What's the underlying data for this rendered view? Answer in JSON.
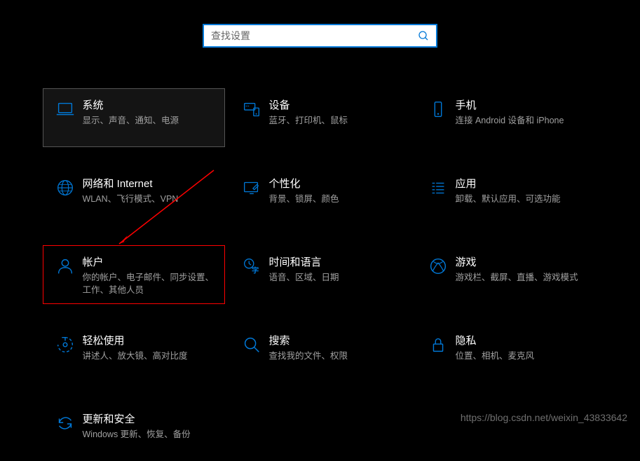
{
  "search": {
    "placeholder": "查找设置"
  },
  "tiles": {
    "system": {
      "title": "系统",
      "desc": "显示、声音、通知、电源"
    },
    "devices": {
      "title": "设备",
      "desc": "蓝牙、打印机、鼠标"
    },
    "phone": {
      "title": "手机",
      "desc": "连接 Android 设备和 iPhone"
    },
    "network": {
      "title": "网络和 Internet",
      "desc": "WLAN、飞行模式、VPN"
    },
    "personalization": {
      "title": "个性化",
      "desc": "背景、锁屏、颜色"
    },
    "apps": {
      "title": "应用",
      "desc": "卸载、默认应用、可选功能"
    },
    "accounts": {
      "title": "帐户",
      "desc": "你的帐户、电子邮件、同步设置、工作、其他人员"
    },
    "timelang": {
      "title": "时间和语言",
      "desc": "语音、区域、日期"
    },
    "gaming": {
      "title": "游戏",
      "desc": "游戏栏、截屏、直播、游戏模式"
    },
    "ease": {
      "title": "轻松使用",
      "desc": "讲述人、放大镜、高对比度"
    },
    "searchtile": {
      "title": "搜索",
      "desc": "查找我的文件、权限"
    },
    "privacy": {
      "title": "隐私",
      "desc": "位置、相机、麦克风"
    },
    "update": {
      "title": "更新和安全",
      "desc": "Windows 更新、恢复、备份"
    }
  },
  "watermark": "https://blog.csdn.net/weixin_43833642"
}
